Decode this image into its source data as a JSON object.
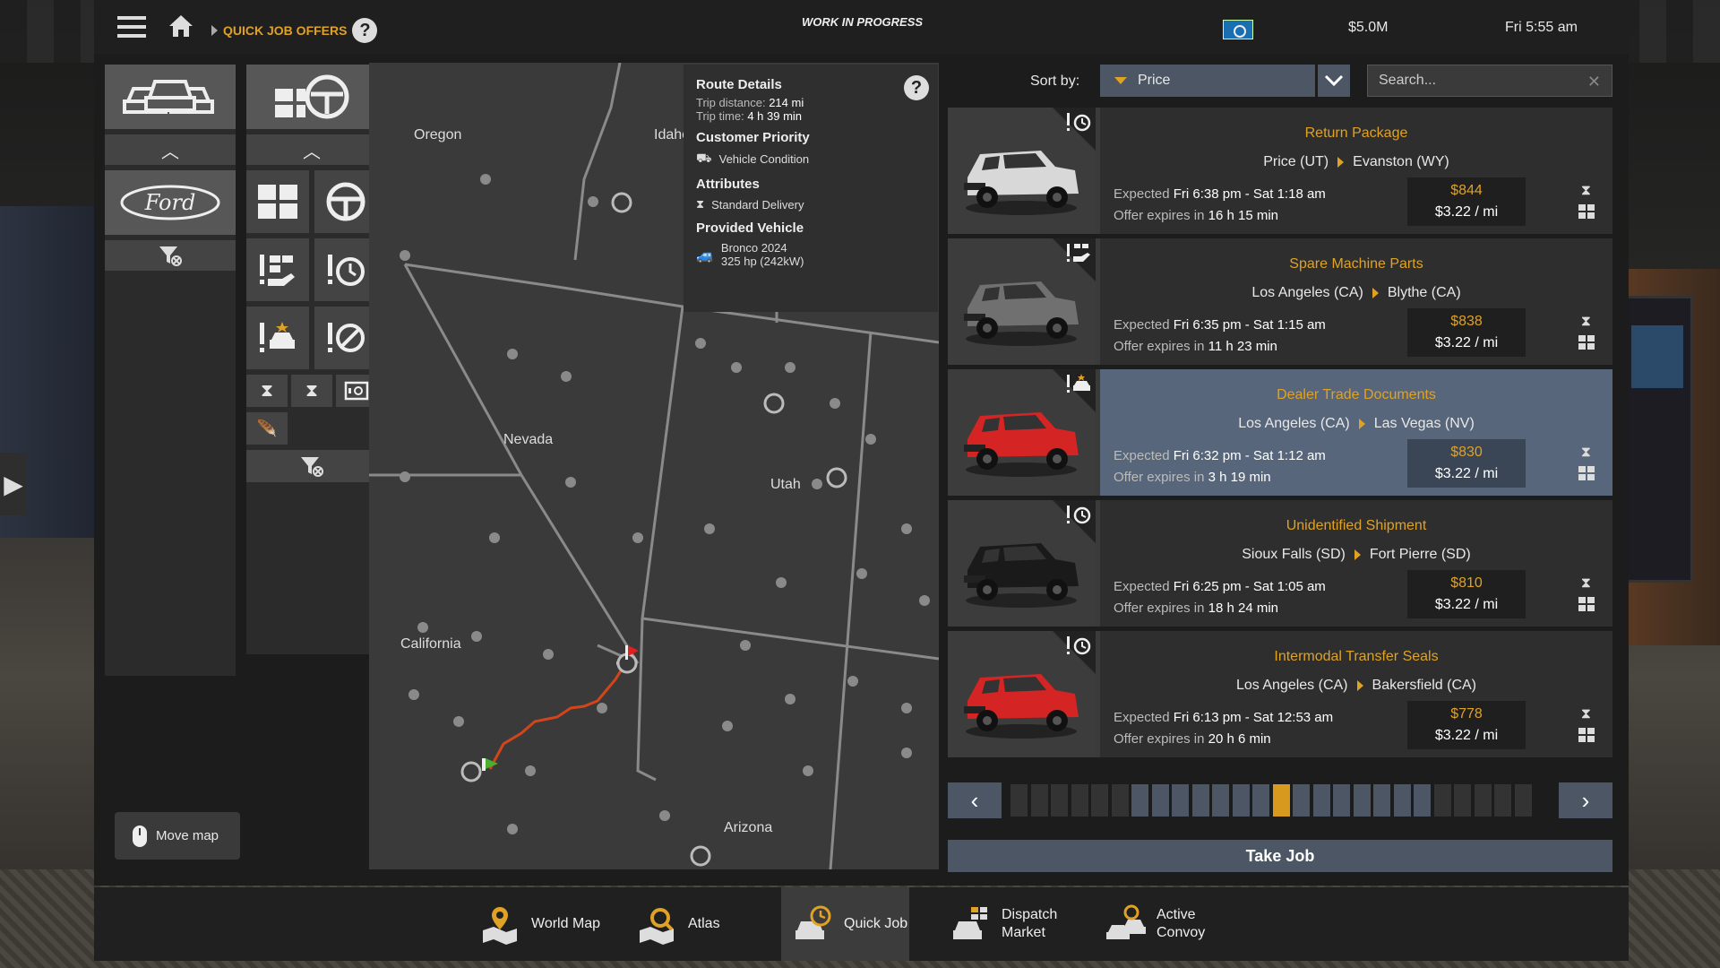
{
  "header": {
    "breadcrumb": "QUICK JOB OFFERS",
    "status": "WORK IN PROGRESS",
    "money": "$5.0M",
    "time": "Fri 5:55 am"
  },
  "filters": {
    "brand": "Ford"
  },
  "map": {
    "labels": [
      "Oregon",
      "Idaho",
      "Nevada",
      "Utah",
      "California",
      "Arizona"
    ],
    "move_map": "Move map"
  },
  "route_details": {
    "heading": "Route Details",
    "distance_label": "Trip distance:",
    "distance": "214 mi",
    "time_label": "Trip time:",
    "time": "4 h 39 min",
    "priority_heading": "Customer Priority",
    "priority": "Vehicle Condition",
    "attributes_heading": "Attributes",
    "attribute": "Standard Delivery",
    "vehicle_heading": "Provided Vehicle",
    "vehicle_name": "Bronco 2024",
    "vehicle_power": "325 hp (242kW)"
  },
  "sort": {
    "label": "Sort by:",
    "value": "Price",
    "search_placeholder": "Search..."
  },
  "jobs": [
    {
      "title": "Return Package",
      "from": "Price (UT)",
      "to": "Evanston (WY)",
      "exp_label": "Expected",
      "expected": "Fri 6:38 pm - Sat 1:18 am",
      "off_label": "Offer expires in",
      "expires": "16 h 15 min",
      "price": "$844",
      "rate": "$3.22 / mi",
      "car_color": "#d8d8d8",
      "badge": "timer"
    },
    {
      "title": "Spare Machine Parts",
      "from": "Los Angeles (CA)",
      "to": "Blythe (CA)",
      "exp_label": "Expected",
      "expected": "Fri 6:35 pm - Sat 1:15 am",
      "off_label": "Offer expires in",
      "expires": "11 h 23 min",
      "price": "$838",
      "rate": "$3.22 / mi",
      "car_color": "#707070",
      "badge": "cargo"
    },
    {
      "title": "Dealer Trade Documents",
      "from": "Los Angeles (CA)",
      "to": "Las Vegas (NV)",
      "exp_label": "Expected",
      "expected": "Fri 6:32 pm - Sat 1:12 am",
      "off_label": "Offer expires in",
      "expires": "3 h 19 min",
      "price": "$830",
      "rate": "$3.22 / mi",
      "car_color": "#d42424",
      "badge": "vehicle"
    },
    {
      "title": "Unidentified Shipment",
      "from": "Sioux Falls (SD)",
      "to": "Fort Pierre (SD)",
      "exp_label": "Expected",
      "expected": "Fri 6:25 pm - Sat 1:05 am",
      "off_label": "Offer expires in",
      "expires": "18 h 24 min",
      "price": "$810",
      "rate": "$3.22 / mi",
      "car_color": "#1a1a1a",
      "badge": "timer"
    },
    {
      "title": "Intermodal Transfer Seals",
      "from": "Los Angeles (CA)",
      "to": "Bakersfield (CA)",
      "exp_label": "Expected",
      "expected": "Fri 6:13 pm - Sat 12:53 am",
      "off_label": "Offer expires in",
      "expires": "20 h 6 min",
      "price": "$778",
      "rate": "$3.22 / mi",
      "car_color": "#d42424",
      "badge": "timer"
    }
  ],
  "pager": {
    "current_page": 14
  },
  "take_job": "Take Job",
  "bottom_nav": [
    {
      "label": "World Map"
    },
    {
      "label": "Atlas"
    },
    {
      "label": "Quick Job"
    },
    {
      "label": "Dispatch",
      "label2": "Market"
    },
    {
      "label": "Active",
      "label2": "Convoy"
    }
  ],
  "colors": {
    "accent": "#e0a224",
    "selected_row": "#57667a",
    "button": "#4d5665"
  }
}
